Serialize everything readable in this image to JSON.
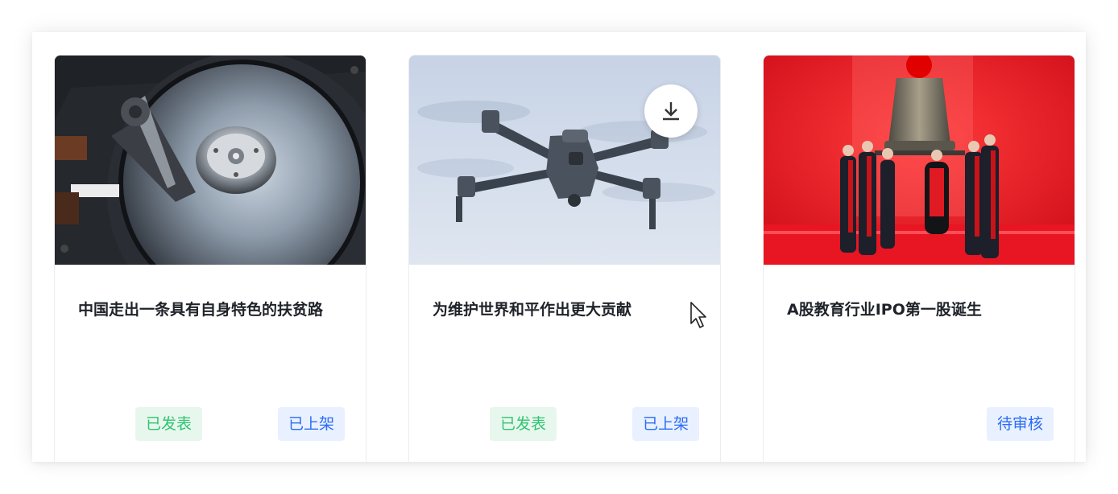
{
  "cards": [
    {
      "title": "中国走出一条具有自身特色的扶贫路",
      "image_subject": "hard-drive",
      "tags": [
        "已发表",
        "已上架"
      ]
    },
    {
      "title": "为维护世界和平作出更大贡献",
      "image_subject": "drone",
      "has_download_button": true,
      "tags": [
        "已发表",
        "已上架"
      ]
    },
    {
      "title": "A股教育行业IPO第一股诞生",
      "image_subject": "bell-ringing-ceremony",
      "tags": [
        "待审核"
      ]
    }
  ],
  "icons": {
    "download": "download-icon",
    "cursor": "mouse-pointer-icon"
  },
  "colors": {
    "published_tag_bg": "#e8f7ee",
    "published_tag_text": "#2fc46f",
    "status_tag_bg": "#e9f0ff",
    "status_tag_text": "#2a6cf5",
    "title_text": "#1f2329"
  }
}
